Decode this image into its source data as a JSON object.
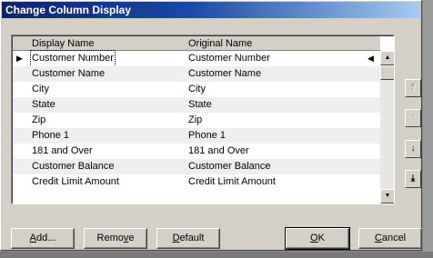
{
  "window": {
    "title": "Change Column Display"
  },
  "grid": {
    "columns": [
      "Display Name",
      "Original Name"
    ],
    "rows": [
      {
        "display": "Customer Number",
        "original": "Customer Number",
        "current": true
      },
      {
        "display": "Customer Name",
        "original": "Customer Name"
      },
      {
        "display": "City",
        "original": "City"
      },
      {
        "display": "State",
        "original": "State"
      },
      {
        "display": "Zip",
        "original": "Zip"
      },
      {
        "display": "Phone 1",
        "original": "Phone 1"
      },
      {
        "display": "181 and Over",
        "original": "181 and Over"
      },
      {
        "display": "Customer Balance",
        "original": "Customer Balance"
      },
      {
        "display": "Credit Limit Amount",
        "original": "Credit Limit Amount"
      }
    ]
  },
  "side_buttons": {
    "move_top": "⤒",
    "move_up": "↑",
    "move_down": "↓",
    "move_bottom": "⤓"
  },
  "buttons": {
    "add": {
      "pre": "",
      "key": "A",
      "post": "dd..."
    },
    "remove": {
      "pre": "Remo",
      "key": "v",
      "post": "e"
    },
    "default": {
      "pre": "",
      "key": "D",
      "post": "efault"
    },
    "ok": {
      "pre": "",
      "key": "O",
      "post": "K"
    },
    "cancel": {
      "pre": "",
      "key": "C",
      "post": "ancel"
    }
  },
  "icons": {
    "row_pointer": "▶",
    "row_end": "◀",
    "scroll_up": "▲",
    "scroll_down": "▼"
  },
  "colors": {
    "title_bar": "#0a246a",
    "face": "#d4d0c8",
    "alt_row": "#eeeeee"
  }
}
